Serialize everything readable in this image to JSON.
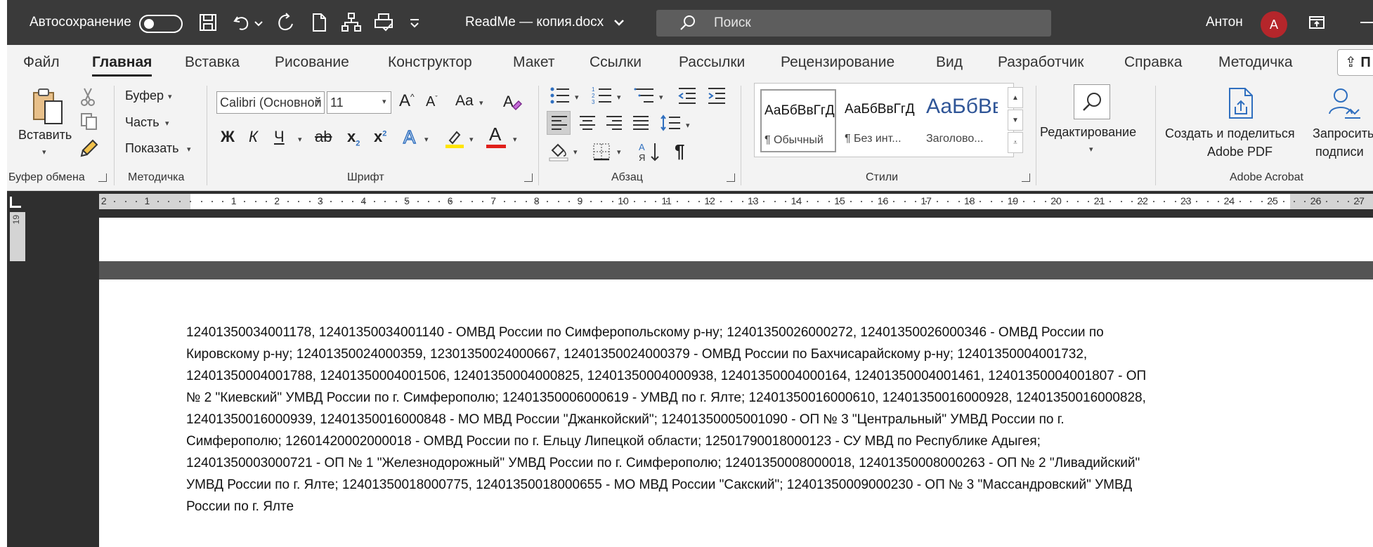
{
  "titlebar": {
    "autosave_label": "Автосохранение",
    "doc_title": "ReadMe — копия.docx",
    "search_placeholder": "Поиск",
    "user_name": "Антон",
    "avatar_initial": "А",
    "icons": [
      "save-icon",
      "undo-icon",
      "redo-icon",
      "new-document-icon",
      "org-chart-icon",
      "print-preview-icon",
      "customize-toolbar-icon",
      "search-icon",
      "ribbon-display-icon",
      "minimize-icon"
    ]
  },
  "tabs": [
    "Файл",
    "Главная",
    "Вставка",
    "Рисование",
    "Конструктор",
    "Макет",
    "Ссылки",
    "Рассылки",
    "Рецензирование",
    "Вид",
    "Разработчик",
    "Справка",
    "Методичка"
  ],
  "active_tab": "Главная",
  "share_label": "П",
  "ribbon": {
    "clipboard": {
      "paste_label": "Вставить",
      "group_label": "Буфер обмена"
    },
    "method": {
      "buffer_label": "Буфер",
      "part_label": "Часть",
      "show_label": "Показать",
      "group_label": "Методичка"
    },
    "font": {
      "font_name": "Calibri (Основной текст)",
      "font_size": "11",
      "case_label": "Aa",
      "bold": "Ж",
      "italic": "К",
      "underline": "Ч",
      "strike": "ab",
      "subscript": "x",
      "superscript": "x",
      "font_color_letter": "A",
      "text_effects_letter": "A",
      "highlight_color": "#ffe500",
      "font_color": "#e0201b",
      "group_label": "Шрифт"
    },
    "paragraph": {
      "group_label": "Абзац",
      "pilcrow": "¶",
      "sort_label": "АЯ"
    },
    "styles": {
      "group_label": "Стили",
      "items": [
        {
          "preview": "АаБбВвГгД",
          "name": "¶ Обычный"
        },
        {
          "preview": "АаБбВвГгД",
          "name": "¶ Без инт..."
        },
        {
          "preview": "АаБбВв",
          "name": "Заголово..."
        }
      ],
      "heading_color": "#2f5597"
    },
    "editing": {
      "label": "Редактирование"
    },
    "acrobat": {
      "create_label_1": "Создать и поделиться",
      "create_label_2": "Adobe PDF",
      "request_label_1": "Запросить",
      "request_label_2": "подписи",
      "group_label": "Adobe Acrobat"
    }
  },
  "ruler": {
    "left_numbers": [
      "2",
      "1"
    ],
    "numbers": [
      "1",
      "2",
      "3",
      "4",
      "5",
      "6",
      "7",
      "8",
      "9",
      "10",
      "11",
      "12",
      "13",
      "14",
      "15",
      "16",
      "17",
      "18",
      "19",
      "20",
      "21",
      "22",
      "23",
      "24",
      "25",
      "26",
      "27"
    ],
    "vertical_number": "19"
  },
  "document": {
    "lines": [
      "12401350034001178, 12401350034001140 - ОМВД России по Симферопольскому р-ну; 12401350026000272, 12401350026000346 - ОМВД России по",
      "Кировскому р-ну; 12401350024000359, 12301350024000667, 12401350024000379 - ОМВД России по Бахчисарайскому р-ну; 12401350004001732,",
      "12401350004001788, 12401350004001506, 12401350004000825, 12401350004000938, 12401350004000164, 12401350004001461, 12401350004001807 - ОП",
      "№ 2 \"Киевский\" УМВД России по г. Симферополю; 12401350006000619 - УМВД по г. Ялте; 12401350016000610, 12401350016000928, 12401350016000828,",
      "12401350016000939, 12401350016000848 - МО МВД России \"Джанкойский\"; 12401350005001090 - ОП № 3 \"Центральный\" УМВД России по г.",
      "Симферополю; 12601420002000018 - ОМВД России по г. Ельцу Липецкой области; 12501790018000123 - СУ МВД по Республике Адыгея;",
      "12401350003000721 - ОП № 1 \"Железнодорожный\" УМВД России по г. Симферополю; 12401350008000018, 12401350008000263 - ОП № 2 \"Ливадийский\"",
      "УМВД России по г. Ялте; 12401350018000775, 12401350018000655 - МО МВД России \"Сакский\"; 12401350009000230 - ОП № 3 \"Массандровский\" УМВД",
      "России по г. Ялте"
    ]
  }
}
